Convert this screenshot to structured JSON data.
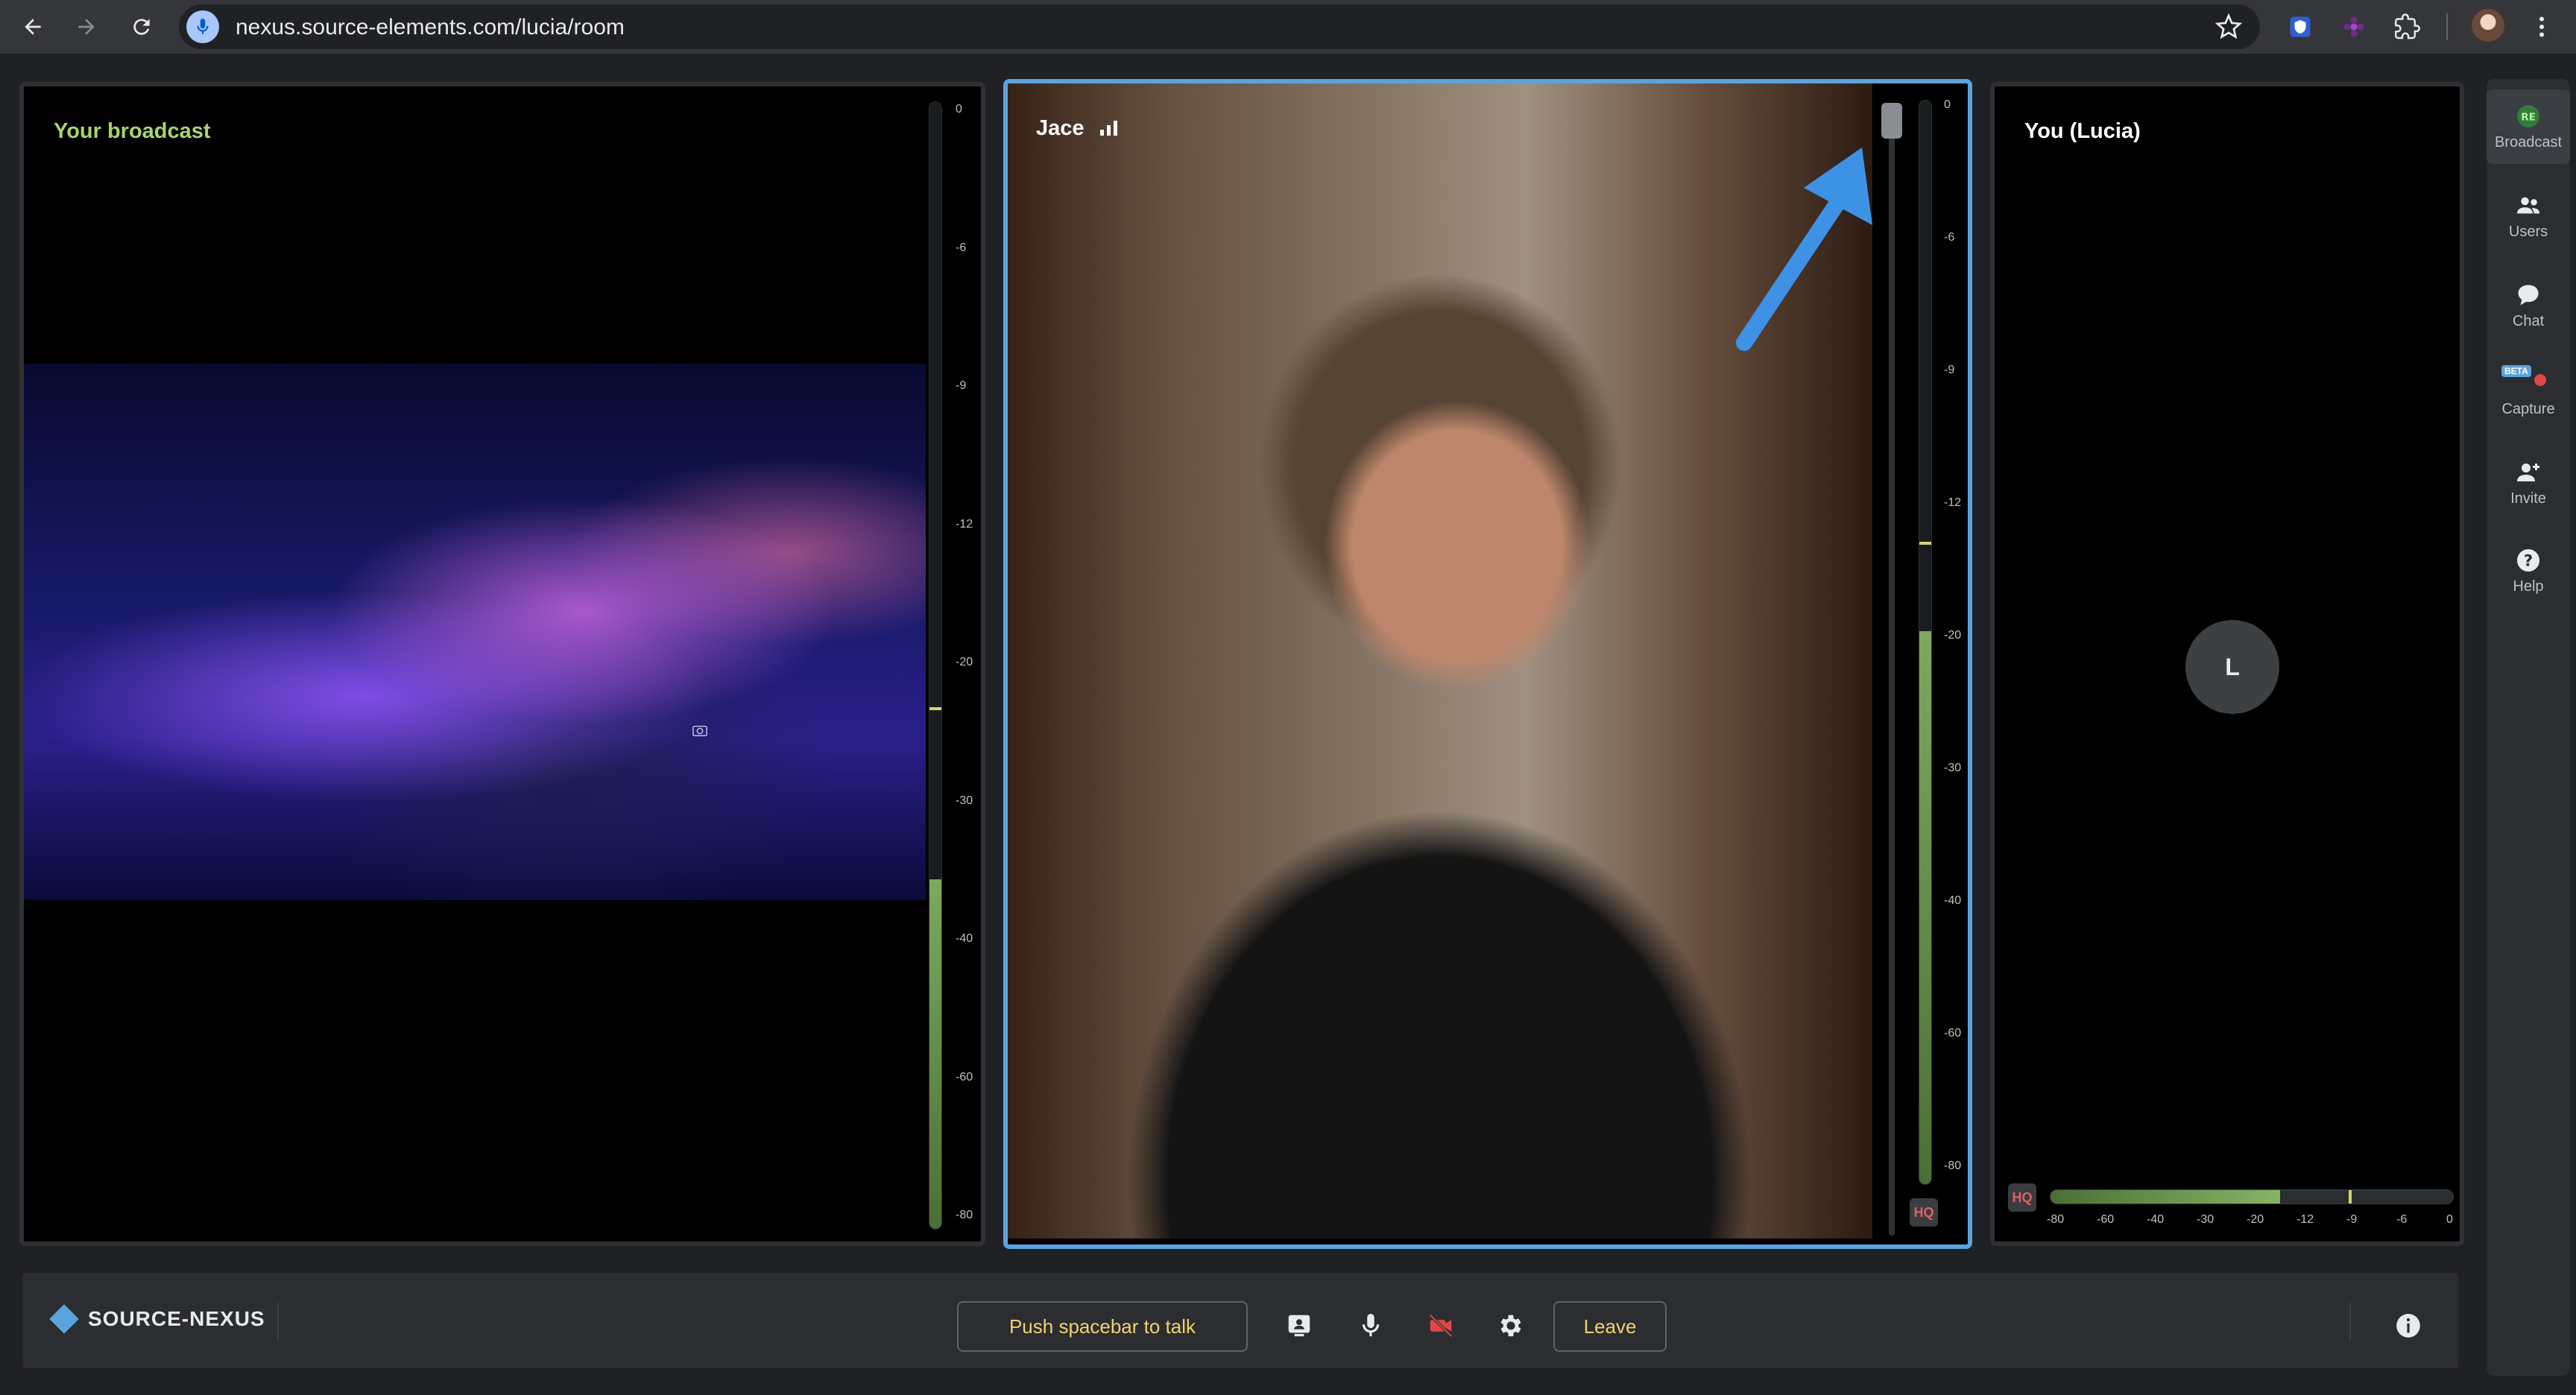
{
  "browser": {
    "url": "nexus.source-elements.com/lucia/room"
  },
  "tiles": {
    "broadcast": {
      "title": "Your broadcast",
      "meter_scale": [
        "0",
        "-6",
        "-9",
        "-12",
        "-20",
        "-30",
        "-40",
        "-60",
        "-80"
      ],
      "level_fraction": 0.31,
      "peak_fraction": 0.46
    },
    "jace": {
      "title": "Jace",
      "meter_scale": [
        "0",
        "-6",
        "-9",
        "-12",
        "-20",
        "-30",
        "-40",
        "-60",
        "-80"
      ],
      "level_fraction": 0.51,
      "peak_fraction": 0.59,
      "hq_label": "HQ"
    },
    "you": {
      "title": "You (Lucia)",
      "avatar_initial": "L",
      "hq_label": "HQ",
      "meter_scale": [
        "-80",
        "-60",
        "-40",
        "-30",
        "-20",
        "-12",
        "-9",
        "-6",
        "0"
      ],
      "level_fraction": 0.57,
      "peak_fraction": 0.74
    }
  },
  "sidebar": {
    "items": [
      {
        "label": "Broadcast",
        "icon": "broadcast-icon"
      },
      {
        "label": "Users",
        "icon": "users-icon"
      },
      {
        "label": "Chat",
        "icon": "chat-icon"
      },
      {
        "label": "Capture",
        "icon": "capture-icon",
        "badge": "BETA"
      },
      {
        "label": "Invite",
        "icon": "invite-icon"
      },
      {
        "label": "Help",
        "icon": "help-icon"
      }
    ]
  },
  "controls": {
    "brand": "SOURCE-NEXUS",
    "push_to_talk": "Push spacebar to talk",
    "leave": "Leave"
  },
  "colors": {
    "accent": "#5aa3dc",
    "meter_green": "#7ea95e",
    "button_text": "#f0d36a",
    "broadcast_title": "#a7d46f",
    "muted_red": "#e04848"
  }
}
